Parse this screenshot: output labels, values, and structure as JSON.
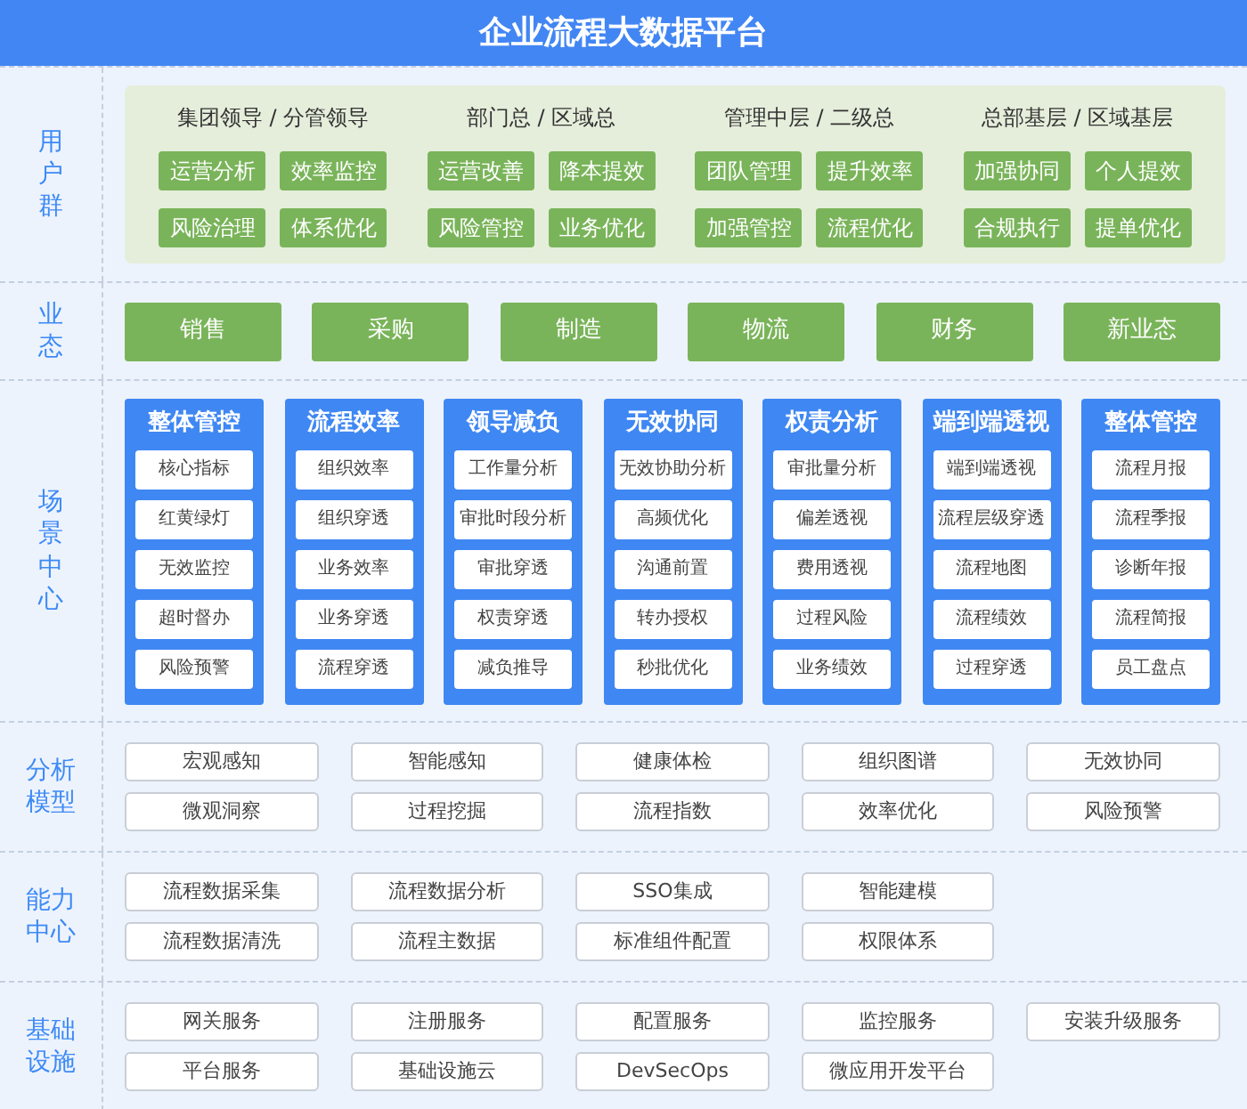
{
  "title": "企业流程大数据平台",
  "sections": [
    {
      "kind": "user_groups",
      "label": "用户群",
      "groups": [
        {
          "title": "集团领导 / 分管领导",
          "items": [
            "运营分析",
            "效率监控",
            "风险治理",
            "体系优化"
          ]
        },
        {
          "title": "部门总 / 区域总",
          "items": [
            "运营改善",
            "降本提效",
            "风险管控",
            "业务优化"
          ]
        },
        {
          "title": "管理中层 / 二级总",
          "items": [
            "团队管理",
            "提升效率",
            "加强管控",
            "流程优化"
          ]
        },
        {
          "title": "总部基层 / 区域基层",
          "items": [
            "加强协同",
            "个人提效",
            "合规执行",
            "提单优化"
          ]
        }
      ]
    },
    {
      "kind": "business",
      "label": "业态",
      "items": [
        "销售",
        "采购",
        "制造",
        "物流",
        "财务",
        "新业态"
      ]
    },
    {
      "kind": "scenarios",
      "label": "场景中心",
      "columns": [
        {
          "title": "整体管控",
          "items": [
            "核心指标",
            "红黄绿灯",
            "无效监控",
            "超时督办",
            "风险预警"
          ]
        },
        {
          "title": "流程效率",
          "items": [
            "组织效率",
            "组织穿透",
            "业务效率",
            "业务穿透",
            "流程穿透"
          ]
        },
        {
          "title": "领导减负",
          "items": [
            "工作量分析",
            "审批时段分析",
            "审批穿透",
            "权责穿透",
            "减负推导"
          ]
        },
        {
          "title": "无效协同",
          "items": [
            "无效协助分析",
            "高频优化",
            "沟通前置",
            "转办授权",
            "秒批优化"
          ]
        },
        {
          "title": "权责分析",
          "items": [
            "审批量分析",
            "偏差透视",
            "费用透视",
            "过程风险",
            "业务绩效"
          ]
        },
        {
          "title": "端到端透视",
          "items": [
            "端到端透视",
            "流程层级穿透",
            "流程地图",
            "流程绩效",
            "过程穿透"
          ]
        },
        {
          "title": "整体管控",
          "items": [
            "流程月报",
            "流程季报",
            "诊断年报",
            "流程简报",
            "员工盘点"
          ]
        }
      ]
    },
    {
      "kind": "grid",
      "label": "分析模型",
      "rows": [
        [
          "宏观感知",
          "智能感知",
          "健康体检",
          "组织图谱",
          "无效协同"
        ],
        [
          "微观洞察",
          "过程挖掘",
          "流程指数",
          "效率优化",
          "风险预警"
        ]
      ]
    },
    {
      "kind": "grid",
      "label": "能力中心",
      "rows": [
        [
          "流程数据采集",
          "流程数据分析",
          "SSO集成",
          "智能建模"
        ],
        [
          "流程数据清洗",
          "流程主数据",
          "标准组件配置",
          "权限体系"
        ]
      ]
    },
    {
      "kind": "grid",
      "label": "基础设施",
      "rows": [
        [
          "网关服务",
          "注册服务",
          "配置服务",
          "监控服务",
          "安装升级服务"
        ],
        [
          "平台服务",
          "基础设施云",
          "DevSecOps",
          "微应用开发平台"
        ]
      ]
    }
  ]
}
